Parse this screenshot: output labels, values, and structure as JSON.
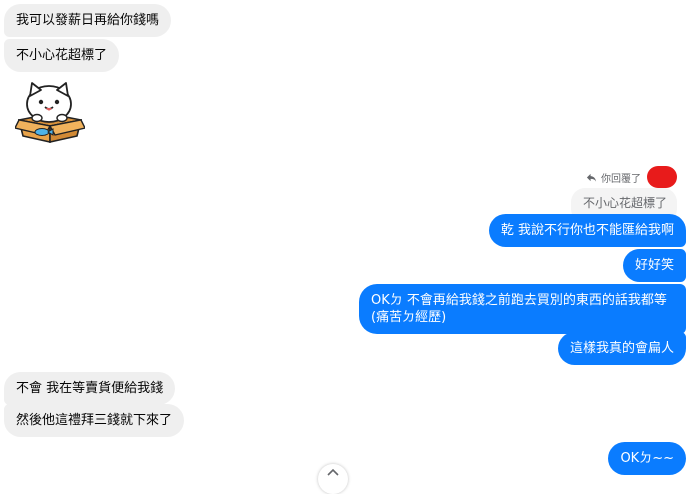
{
  "messages": {
    "m1": "我可以發薪日再給你錢嗎",
    "m2": "不小心花超標了",
    "reply_meta": "你回覆了",
    "quoted": "不小心花超標了",
    "m3": "乾 我說不行你也不能匯給我啊",
    "m4": "好好笑",
    "m5": "OKㄉ 不會再給我錢之前跑去買別的東西的話我都等(痛苦ㄉ經歷)",
    "m6": "這樣我真的會扁人",
    "m7": "不會 我在等賣貨便給我錢",
    "m8": "然後他這禮拜三錢就下來了",
    "m9": "OKㄉ~~"
  },
  "colors": {
    "outgoing_bubble": "#0a7cff",
    "incoming_bubble": "#efefef",
    "avatar_redacted": "#e81b1b"
  },
  "sticker": {
    "icon": "cat-in-box-sticker"
  }
}
